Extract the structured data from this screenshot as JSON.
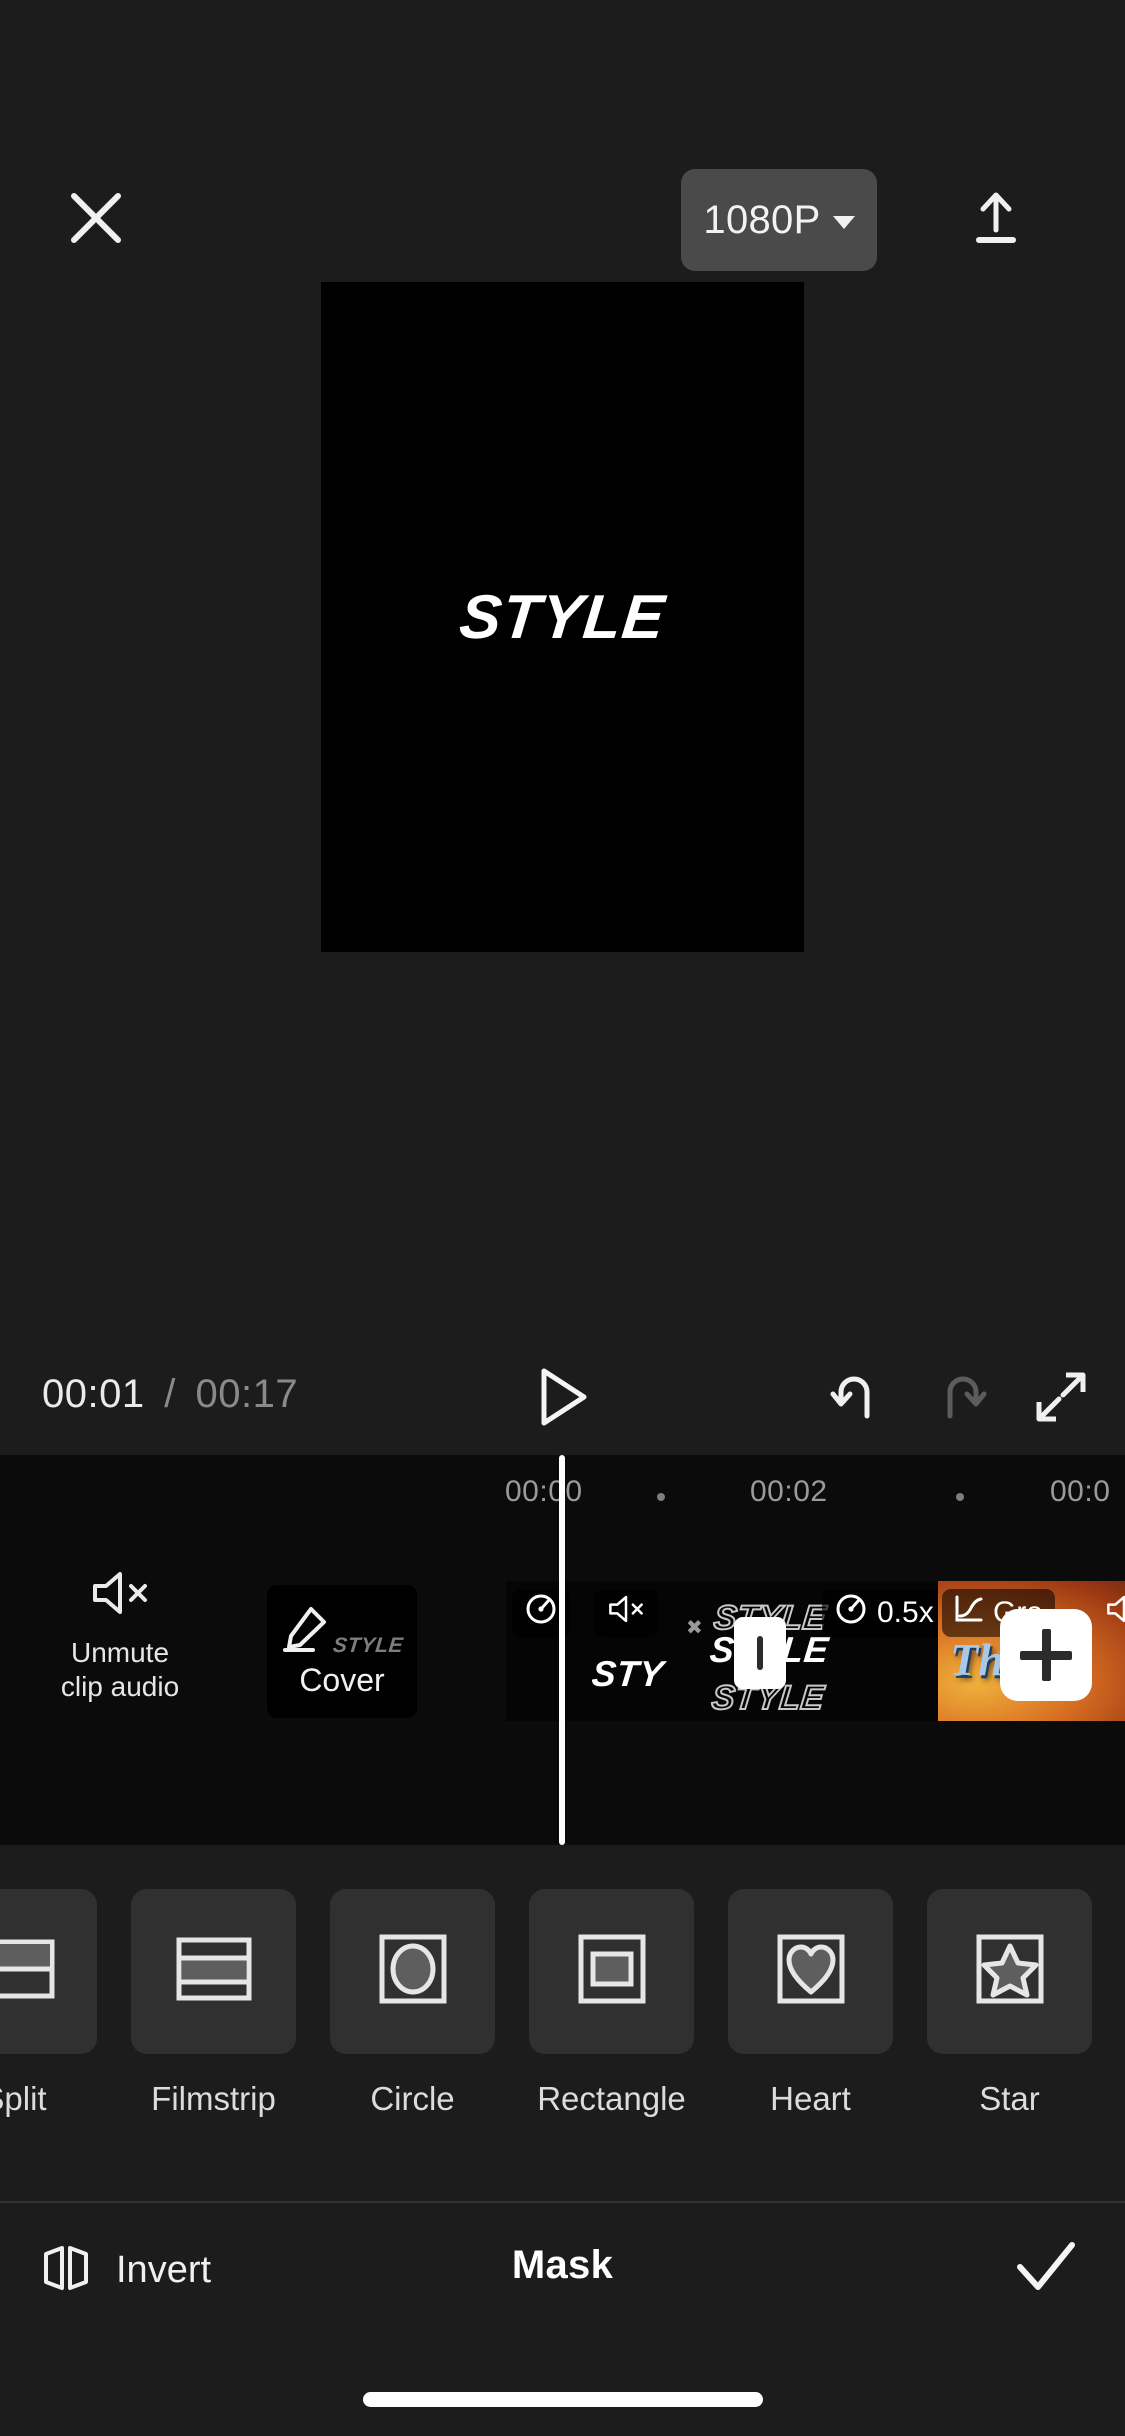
{
  "app": {
    "background": "#1c1c1c",
    "timeline_background": "#0b0b0b"
  },
  "topbar": {
    "close_icon": "close-x-icon",
    "resolution_label": "1080P",
    "resolution_caret_icon": "chevron-down-icon",
    "export_icon": "upload-export-icon"
  },
  "preview": {
    "title_text": "STYLE",
    "canvas_background": "#000000",
    "text_color": "#ffffff"
  },
  "playback": {
    "current_time": "00:01",
    "separator": "/",
    "total_time": "00:17",
    "play_icon": "play-triangle-icon",
    "undo_icon": "undo-arrow-icon",
    "redo_icon": "redo-arrow-icon",
    "fullscreen_icon": "fullscreen-expand-icon",
    "undo_enabled": true,
    "redo_enabled": false
  },
  "timeline": {
    "ruler_labels": [
      "00:00",
      "00:02",
      "00:0"
    ],
    "ruler_dots": 2,
    "playhead_time": "00:01",
    "unmute": {
      "icon": "speaker-muted-icon",
      "label_line1": "Unmute",
      "label_line2": "clip audio"
    },
    "cover": {
      "icon": "pencil-edit-icon",
      "thumb_text": "STYLE",
      "label": "Cover"
    },
    "clips": [
      {
        "name": "clip-1",
        "speed_icon": "speedometer-icon",
        "mute_icon": "speaker-muted-icon",
        "inner_text": "STY"
      },
      {
        "name": "clip-2",
        "speed_badge": "0.5x",
        "speed_icon": "speedometer-icon",
        "inner_text": "STYLE"
      },
      {
        "name": "clip-3-thumbnail",
        "effect_icon": "graph-curve-icon",
        "effect_label": "Gra",
        "mute_icon": "speaker-muted-icon",
        "thumb_script": "The",
        "thumb_color": "#d86f22"
      }
    ],
    "add_button_icon": "plus-icon",
    "selection_handle_icon": "trim-handle-icon"
  },
  "mask_options": [
    {
      "label": "Split",
      "icon": "mask-split-icon"
    },
    {
      "label": "Filmstrip",
      "icon": "mask-filmstrip-icon"
    },
    {
      "label": "Circle",
      "icon": "mask-circle-icon"
    },
    {
      "label": "Rectangle",
      "icon": "mask-rectangle-icon"
    },
    {
      "label": "Heart",
      "icon": "mask-heart-icon"
    },
    {
      "label": "Star",
      "icon": "mask-star-icon"
    }
  ],
  "bottombar": {
    "invert_icon": "invert-mirror-icon",
    "invert_label": "Invert",
    "title": "Mask",
    "confirm_icon": "checkmark-icon"
  }
}
